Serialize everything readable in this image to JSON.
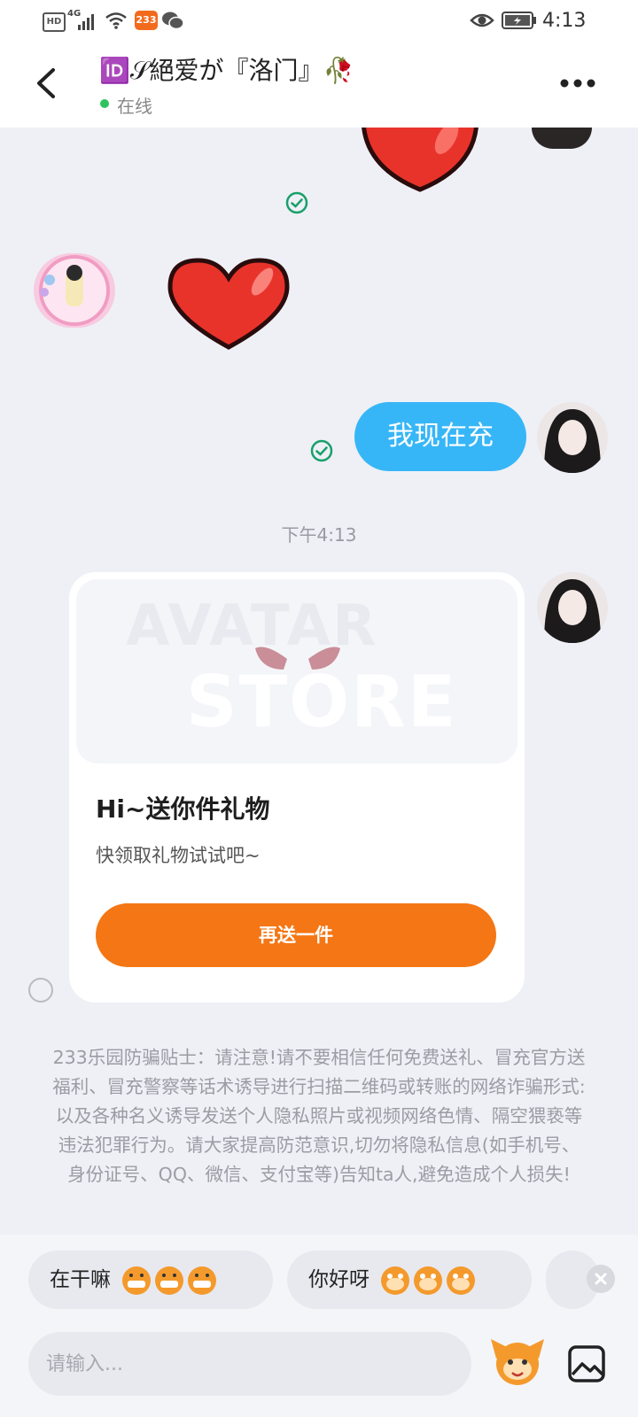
{
  "status_bar": {
    "hd_label": "HD",
    "network_label": "4G",
    "app_badge": "233",
    "time": "4:13"
  },
  "header": {
    "title": "🆔𝒮絕爱が『洛门』🥀",
    "presence": "在线"
  },
  "messages": {
    "outgoing_text": "我现在充",
    "timestamp": "下午4:13"
  },
  "gift_card": {
    "banner_watermark_1": "AVATAR",
    "banner_watermark_2": "STORE",
    "title": "Hi~送你件礼物",
    "subtitle": "快领取礼物试试吧~",
    "button_label": "再送一件"
  },
  "safety_notice": "233乐园防骗贴士：请注意!请不要相信任何免费送礼、冒充官方送福利、冒充警察等话术诱导进行扫描二维码或转账的网络诈骗形式:以及各种名义诱导发送个人隐私照片或视频网络色情、隔空猥亵等违法犯罪行为。请大家提高防范意识,切勿将隐私信息(如手机号、身份证号、QQ、微信、支付宝等)告知ta人,避免造成个人损失!",
  "quick_replies": [
    "在干嘛",
    "你好呀"
  ],
  "input": {
    "placeholder": "请输入..."
  },
  "colors": {
    "accent_orange": "#f47614",
    "bubble_blue": "#37b6f7",
    "online_green": "#2fc35e",
    "check_green": "#18a06a"
  }
}
